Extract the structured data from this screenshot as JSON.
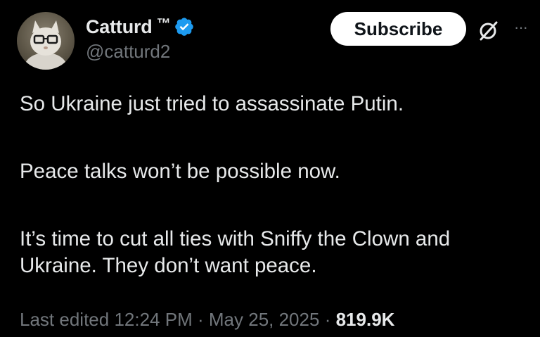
{
  "author": {
    "display_name": "Catturd",
    "trademark": "™",
    "handle": "@catturd2",
    "avatar_icon": "cat-with-glasses-avatar",
    "verified_icon": "verified-badge-icon",
    "verified_color": "#1d9bf0"
  },
  "actions": {
    "subscribe_label": "Subscribe",
    "grok_icon": "grok-icon",
    "more_icon": "more-options-icon",
    "more_glyph": "···"
  },
  "tweet": {
    "paragraph_1": "So Ukraine just tried to assassinate Putin.",
    "paragraph_2": "Peace talks won’t be possible now.",
    "paragraph_3": "It’s time to cut all ties with Sniffy the Clown and Ukraine. They don’t want peace."
  },
  "meta": {
    "edited_label": "Last edited",
    "time": "12:24 PM",
    "date": "May 25, 2025",
    "separator": "·",
    "views": "819.9K"
  },
  "colors": {
    "background": "#000000",
    "text_primary": "#e7e9ea",
    "text_secondary": "#71767b",
    "button_bg": "#ffffff"
  }
}
